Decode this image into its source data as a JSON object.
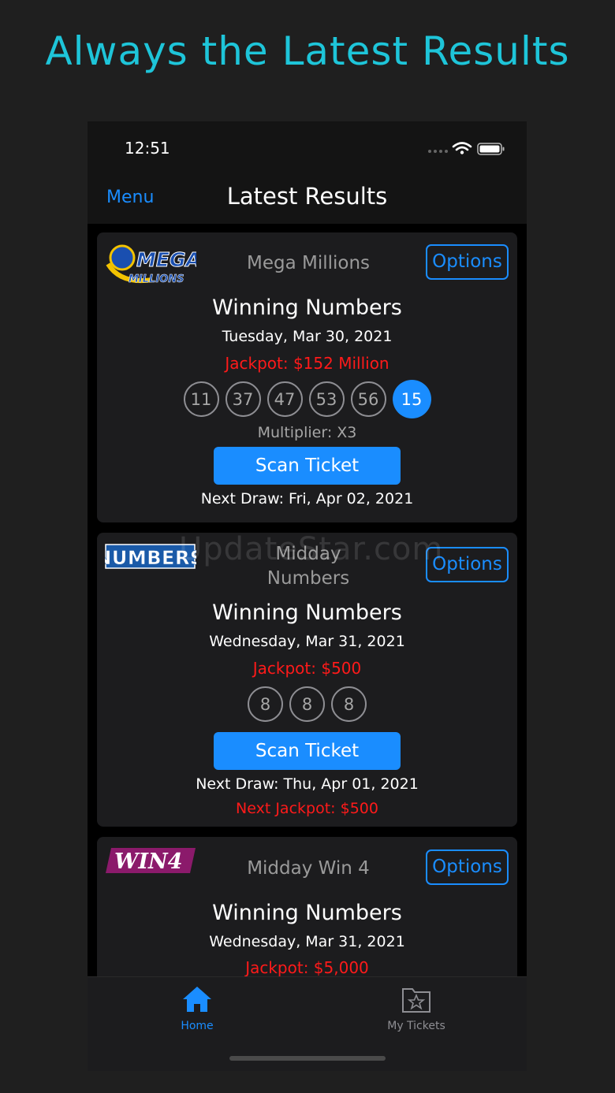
{
  "headline": "Always the Latest Results",
  "status_bar": {
    "time": "12:51"
  },
  "nav": {
    "menu_label": "Menu",
    "title": "Latest Results"
  },
  "watermark": "UpdateStar.com",
  "cards": [
    {
      "logo_text": "MEGA MILLIONS",
      "name": "Mega Millions",
      "options_label": "Options",
      "winning_label": "Winning Numbers",
      "date": "Tuesday, Mar 30, 2021",
      "jackpot": "Jackpot: $152 Million",
      "numbers": [
        "11",
        "37",
        "47",
        "53",
        "56"
      ],
      "bonus": "15",
      "multiplier": "Multiplier: X3",
      "scan_label": "Scan Ticket",
      "next_draw": "Next Draw: Fri, Apr 02, 2021"
    },
    {
      "logo_text": "NUMBERS",
      "name_line1": "Midday",
      "name_line2": "Numbers",
      "options_label": "Options",
      "winning_label": "Winning Numbers",
      "date": "Wednesday, Mar 31, 2021",
      "jackpot": "Jackpot: $500",
      "numbers": [
        "8",
        "8",
        "8"
      ],
      "scan_label": "Scan Ticket",
      "next_draw": "Next Draw: Thu, Apr 01, 2021",
      "next_jackpot": "Next Jackpot: $500"
    },
    {
      "logo_text": "WIN4",
      "name": "Midday Win 4",
      "options_label": "Options",
      "winning_label": "Winning Numbers",
      "date": "Wednesday, Mar 31, 2021",
      "jackpot": "Jackpot: $5,000"
    }
  ],
  "tabs": [
    {
      "label": "Home",
      "icon": "home-icon",
      "active": true
    },
    {
      "label": "My Tickets",
      "icon": "tickets-folder-icon",
      "active": false
    }
  ],
  "colors": {
    "accent": "#1a8dff",
    "jackpot": "#ff1a1a",
    "headline": "#1ec5d9"
  }
}
